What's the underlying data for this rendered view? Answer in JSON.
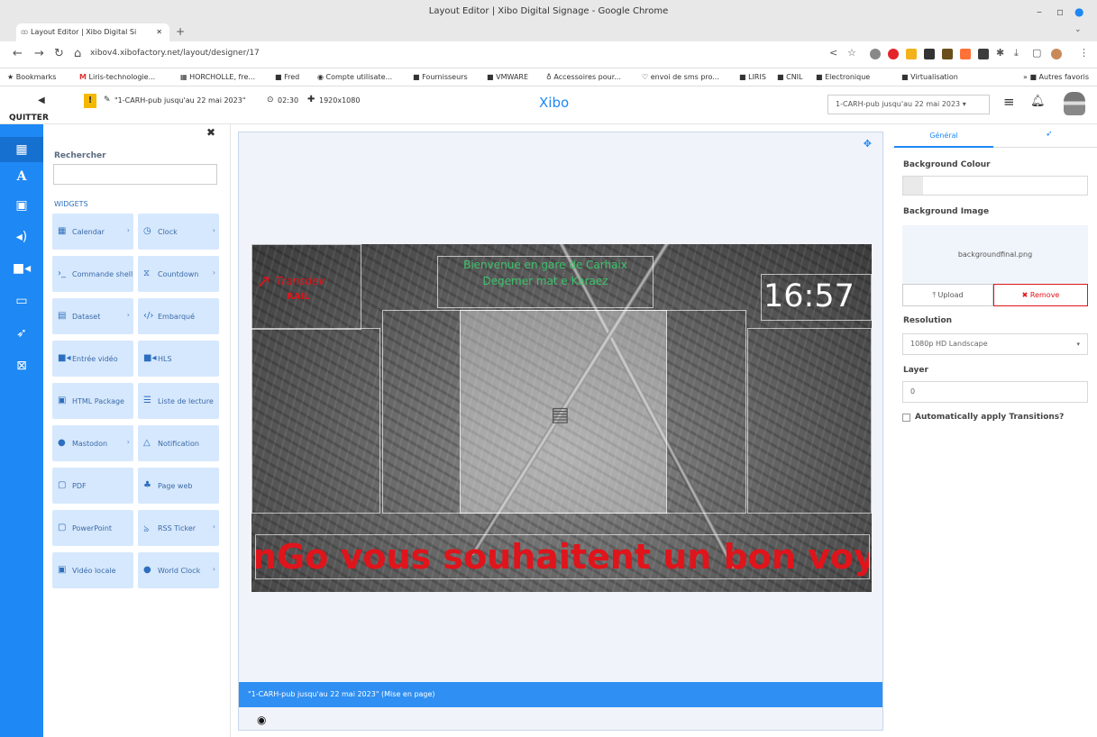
{
  "browser": {
    "window_title": "Layout Editor | Xibo Digital Signage - Google Chrome",
    "tab_title": "Layout Editor | Xibo Digital Si",
    "url": "xibov4.xibofactory.net/layout/designer/17",
    "bookmarks": [
      "Bookmarks",
      "Liris-technologie...",
      "HORCHOLLE, fre...",
      "Fred",
      "Compte utilisate...",
      "Fournisseurs",
      "VMWARE",
      "Accessoires pour...",
      "envoi de sms pro...",
      "LIRIS",
      "CNIL",
      "Electronique",
      "Virtualisation",
      "Autres favoris"
    ]
  },
  "header": {
    "back_label": "QUITTER",
    "warning": "!",
    "layout_name": "\"1-CARH-pub jusqu'au 22 mai 2023\"",
    "duration": "02:30",
    "resolution": "1920x1080",
    "logo": "Xibo",
    "layout_select": "1-CARH-pub jusqu'au 22 mai 2023"
  },
  "widgets_panel": {
    "search_label": "Rechercher",
    "search_value": "",
    "section_title": "WIDGETS",
    "items": [
      {
        "label": "Calendar",
        "icon": "calendar-icon",
        "sub": true
      },
      {
        "label": "Clock",
        "icon": "clock-icon",
        "sub": true
      },
      {
        "label": "Commande shell",
        "icon": "terminal-icon",
        "sub": false
      },
      {
        "label": "Countdown",
        "icon": "hourglass-icon",
        "sub": true
      },
      {
        "label": "Dataset",
        "icon": "table-icon",
        "sub": true
      },
      {
        "label": "Embarqué",
        "icon": "code-icon",
        "sub": false
      },
      {
        "label": "Entrée vidéo",
        "icon": "camera-icon",
        "sub": false
      },
      {
        "label": "HLS",
        "icon": "video-icon",
        "sub": false
      },
      {
        "label": "HTML Package",
        "icon": "package-icon",
        "sub": false
      },
      {
        "label": "Liste de lecture",
        "icon": "list-icon",
        "sub": false
      },
      {
        "label": "Mastodon",
        "icon": "mastodon-icon",
        "sub": true
      },
      {
        "label": "Notification",
        "icon": "bell-icon",
        "sub": false
      },
      {
        "label": "PDF",
        "icon": "pdf-icon",
        "sub": false
      },
      {
        "label": "Page web",
        "icon": "sitemap-icon",
        "sub": false
      },
      {
        "label": "PowerPoint",
        "icon": "powerpoint-icon",
        "sub": false
      },
      {
        "label": "RSS Ticker",
        "icon": "rss-icon",
        "sub": true
      },
      {
        "label": "Vidéo locale",
        "icon": "local-video-icon",
        "sub": false
      },
      {
        "label": "World Clock",
        "icon": "globe-icon",
        "sub": true
      }
    ]
  },
  "canvas": {
    "brand_text": "Transdev",
    "brand_sub": "RAIL",
    "welcome_line1": "Bienvenue en gare de Carhaix",
    "welcome_line2": "Degemer mat e Karaez",
    "clock_text": "16:57",
    "ticker_text": "nGo vous souhaitent un bon voy",
    "footer_label": "\"1-CARH-pub jusqu'au 22 mai 2023\" (Mise en page)"
  },
  "properties": {
    "tab_general": "Général",
    "background_colour_label": "Background Colour",
    "background_image_label": "Background Image",
    "background_image_file": "backgroundfinal.png",
    "upload_label": "Upload",
    "remove_label": "Remove",
    "resolution_label": "Resolution",
    "resolution_value": "1080p HD Landscape",
    "layer_label": "Layer",
    "layer_value": "0",
    "transitions_label": "Automatically apply Transitions?"
  },
  "colors": {
    "accent": "#1e88f5",
    "widget_bg": "#d6e8fd",
    "ticker": "#e0141b",
    "remove": "#e0141b",
    "welcome": "#3cc36b"
  }
}
